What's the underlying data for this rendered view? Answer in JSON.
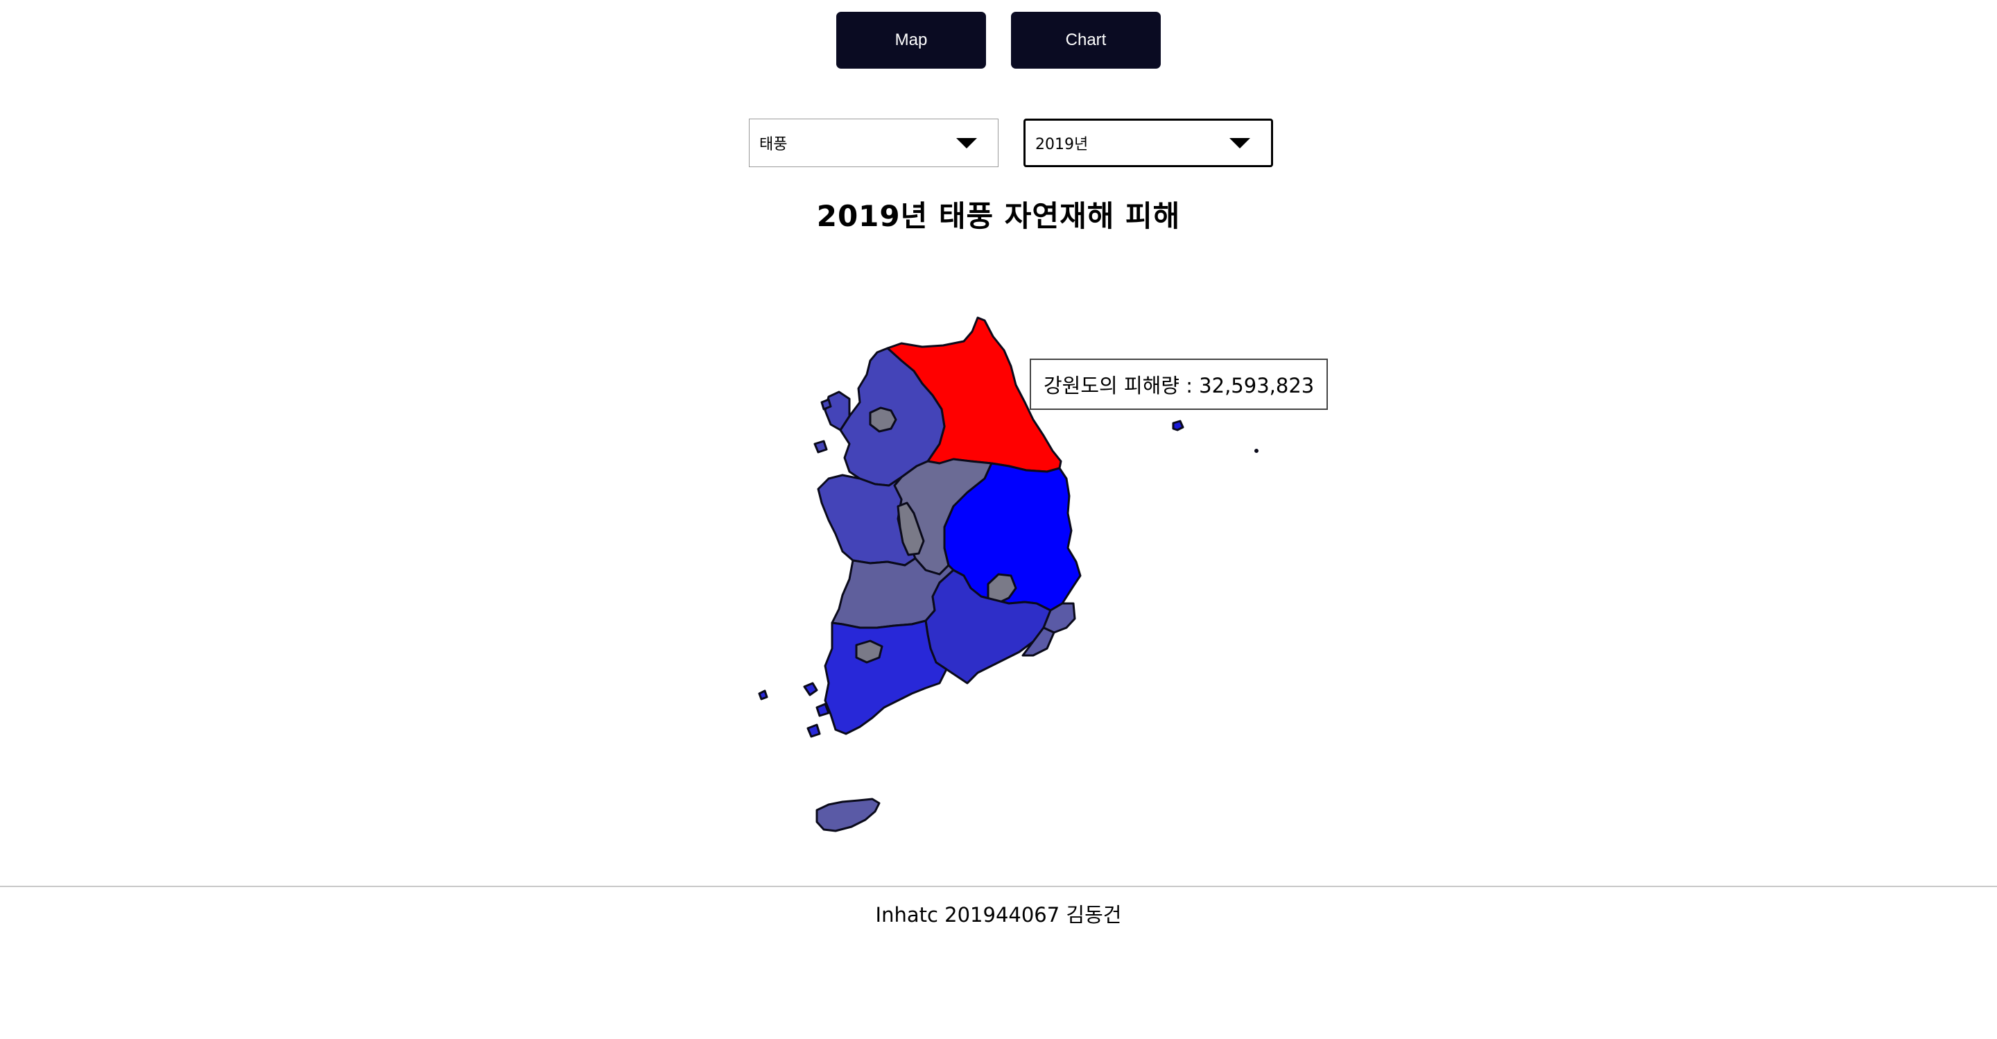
{
  "nav": {
    "map_label": "Map",
    "chart_label": "Chart"
  },
  "filters": {
    "disaster_type": "태풍",
    "year": "2019년"
  },
  "title": "2019년 태풍 자연재해 피해",
  "tooltip": {
    "text": "강원도의 피해량 : 32,593,823"
  },
  "map": {
    "colors": {
      "gangwon": "#ff0000",
      "gyeongbuk": "#0000ff",
      "gyeonggi": "#4444b8",
      "chungnam": "#4444b8",
      "chungbuk": "#6b6b95",
      "jeonbuk": "#5f5f9c",
      "jeonnam": "#2828d8",
      "gyeongnam": "#2e2ec8",
      "ulsan": "#5a5aa6",
      "busan": "#5a5aa6",
      "seoul": "#7a7a88",
      "incheon": "#4444b8",
      "daejeon": "#7a7a88",
      "sejong": "#7a7a88",
      "daegu": "#7a7a88",
      "gwangju": "#7a7a88",
      "jeju": "#5a5aa6",
      "ulleung": "#1a1ad8"
    }
  },
  "footer": {
    "text": "Inhatc 201944067 김동건"
  }
}
